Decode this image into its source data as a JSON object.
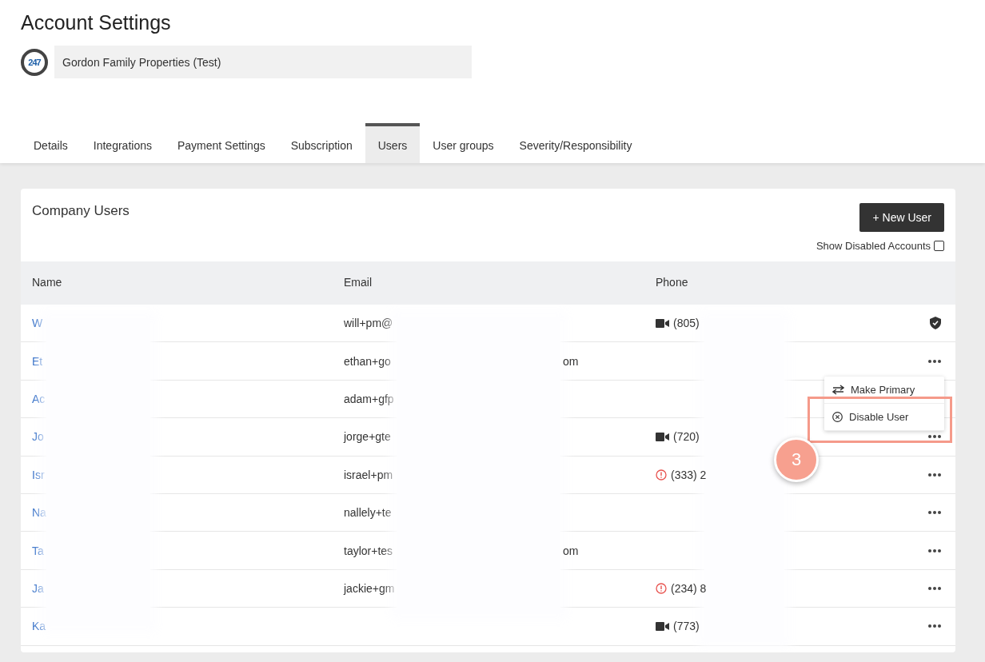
{
  "page_title": "Account Settings",
  "company": {
    "logo": "247",
    "name": "Gordon Family Properties (Test)"
  },
  "tabs": [
    {
      "label": "Details",
      "selected": false
    },
    {
      "label": "Integrations",
      "selected": false
    },
    {
      "label": "Payment Settings",
      "selected": false
    },
    {
      "label": "Subscription",
      "selected": false
    },
    {
      "label": "Users",
      "selected": true
    },
    {
      "label": "User groups",
      "selected": false
    },
    {
      "label": "Severity/Responsibility",
      "selected": false
    }
  ],
  "card": {
    "title": "Company Users",
    "new_button": "+ New User",
    "show_disabled": {
      "label": "Show Disabled Accounts",
      "checked": false
    }
  },
  "table": {
    "columns": [
      "Name",
      "Email",
      "Phone"
    ],
    "rows": [
      {
        "name": "W",
        "email": "will+pm@",
        "phone": {
          "kind": "video",
          "text": "(805)"
        },
        "action": {
          "kind": "shield"
        }
      },
      {
        "name": "Et",
        "email": "ethan+go",
        "email_tail": "om",
        "action": {
          "kind": "more"
        }
      },
      {
        "name": "Ac",
        "email": "adam+gfp"
      },
      {
        "name": "Jo",
        "email": "jorge+gte",
        "phone": {
          "kind": "video",
          "text": "(720)"
        },
        "action": {
          "kind": "more"
        }
      },
      {
        "name": "Isr",
        "email": "israel+pm",
        "phone": {
          "kind": "alert",
          "text": "(333) 2"
        },
        "action": {
          "kind": "more"
        }
      },
      {
        "name": "Na",
        "email": "nallely+te",
        "action": {
          "kind": "more"
        }
      },
      {
        "name": "Ta",
        "email": "taylor+tes",
        "email_tail": "om",
        "action": {
          "kind": "more"
        }
      },
      {
        "name": "Ja",
        "email": "jackie+gm",
        "phone": {
          "kind": "alert",
          "text": "(234) 8"
        },
        "action": {
          "kind": "more"
        }
      },
      {
        "name": "Ka",
        "phone": {
          "kind": "video",
          "text": "(773)"
        },
        "action": {
          "kind": "more"
        }
      }
    ]
  },
  "menu": {
    "items": [
      {
        "label": "Make Primary",
        "kind": "swap"
      },
      {
        "label": "Disable User",
        "kind": "disable"
      }
    ]
  },
  "callout": {
    "step": "3"
  }
}
